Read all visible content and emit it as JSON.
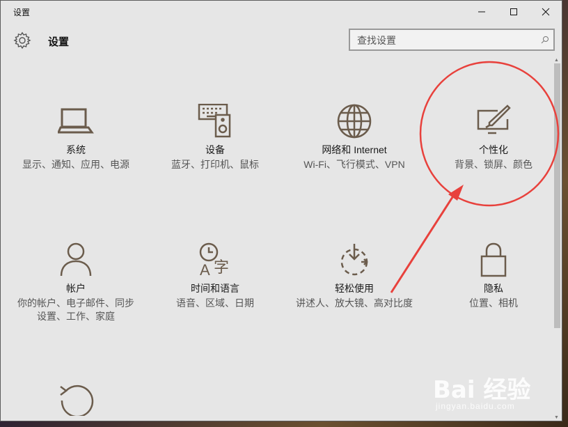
{
  "window": {
    "title": "设置",
    "controls": [
      "minimize-icon",
      "maximize-icon",
      "close-icon"
    ]
  },
  "header": {
    "title": "设置",
    "icon": "gear-icon",
    "search": {
      "placeholder": "查找设置",
      "icon": "search-icon"
    }
  },
  "tiles": [
    {
      "icon": "laptop-icon",
      "name": "系统",
      "desc": "显示、通知、应用、电源"
    },
    {
      "icon": "devices-icon",
      "name": "设备",
      "desc": "蓝牙、打印机、鼠标"
    },
    {
      "icon": "globe-icon",
      "name": "网络和 Internet",
      "desc": "Wi-Fi、飞行模式、VPN"
    },
    {
      "icon": "personalization-icon",
      "name": "个性化",
      "desc": "背景、锁屏、颜色"
    },
    {
      "icon": "person-icon",
      "name": "帐户",
      "desc": "你的帐户、电子邮件、同步设置、工作、家庭"
    },
    {
      "icon": "time-language-icon",
      "name": "时间和语言",
      "desc": "语音、区域、日期"
    },
    {
      "icon": "ease-of-access-icon",
      "name": "轻松使用",
      "desc": "讲述人、放大镜、高对比度"
    },
    {
      "icon": "lock-icon",
      "name": "隐私",
      "desc": "位置、相机"
    },
    {
      "icon": "update-icon",
      "name": "",
      "desc": ""
    }
  ],
  "colors": {
    "icon": "#6b5c4c",
    "window_bg": "#e6e6e6",
    "annotation": "#e8413c"
  },
  "watermark": {
    "main": "Bai 经验",
    "sub": "jingyan.baidu.com"
  }
}
